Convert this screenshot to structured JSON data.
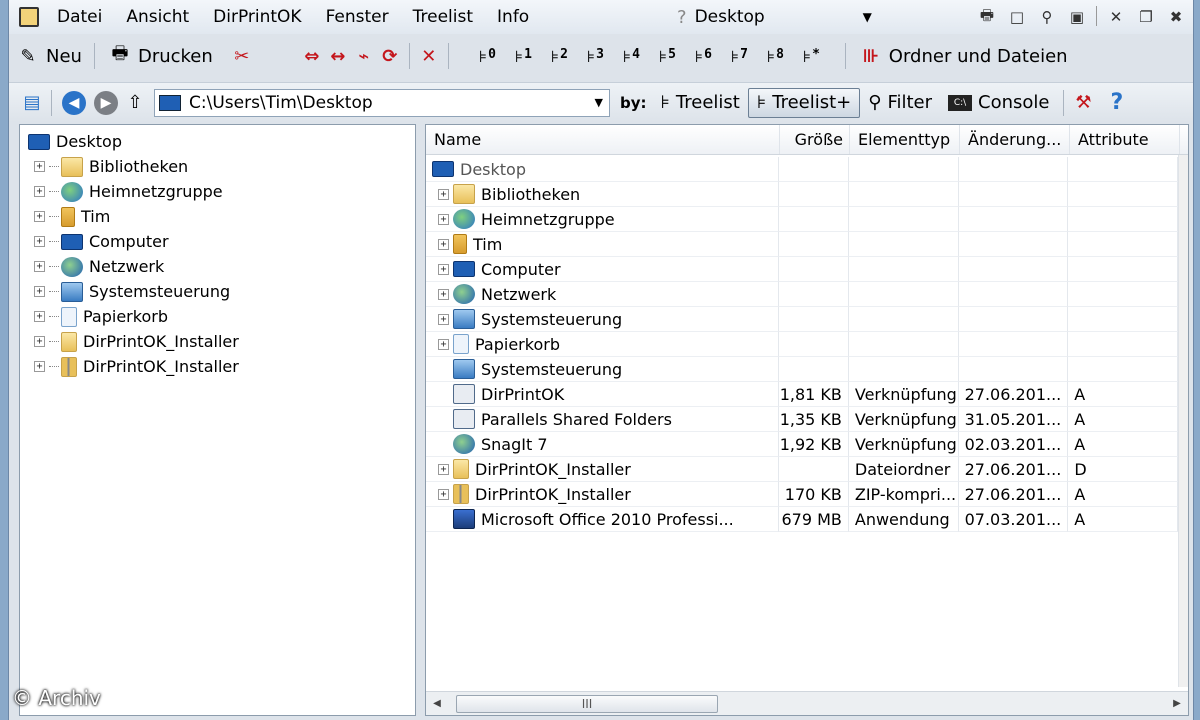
{
  "menu": {
    "items": [
      "Datei",
      "Ansicht",
      "DirPrintOK",
      "Fenster",
      "Treelist",
      "Info"
    ]
  },
  "window_title": "Desktop",
  "toolbar": {
    "new_label": "Neu",
    "print_label": "Drucken",
    "levels": [
      "0",
      "1",
      "2",
      "3",
      "4",
      "5",
      "6",
      "7",
      "8",
      "*"
    ],
    "folders_files_label": "Ordner und Dateien"
  },
  "nav": {
    "path": "C:\\Users\\Tim\\Desktop",
    "by_label": "by:",
    "treelist_label": "Treelist",
    "treelist_plus_label": "Treelist+",
    "filter_label": "Filter",
    "console_label": "Console"
  },
  "tree": {
    "root": "Desktop",
    "items": [
      "Bibliotheken",
      "Heimnetzgruppe",
      "Tim",
      "Computer",
      "Netzwerk",
      "Systemsteuerung",
      "Papierkorb",
      "DirPrintOK_Installer",
      "DirPrintOK_Installer"
    ]
  },
  "list": {
    "columns": {
      "name": "Name",
      "size": "Größe",
      "type": "Elementtyp",
      "date": "Änderung...",
      "attr": "Attribute"
    },
    "root": "Desktop",
    "rows": [
      {
        "name": "Bibliotheken",
        "size": "",
        "type": "",
        "date": "",
        "attr": ""
      },
      {
        "name": "Heimnetzgruppe",
        "size": "",
        "type": "",
        "date": "",
        "attr": ""
      },
      {
        "name": "Tim",
        "size": "",
        "type": "",
        "date": "",
        "attr": ""
      },
      {
        "name": "Computer",
        "size": "",
        "type": "",
        "date": "",
        "attr": ""
      },
      {
        "name": "Netzwerk",
        "size": "",
        "type": "",
        "date": "",
        "attr": ""
      },
      {
        "name": "Systemsteuerung",
        "size": "",
        "type": "",
        "date": "",
        "attr": ""
      },
      {
        "name": "Papierkorb",
        "size": "",
        "type": "",
        "date": "",
        "attr": ""
      },
      {
        "name": "Systemsteuerung",
        "size": "",
        "type": "",
        "date": "",
        "attr": ""
      },
      {
        "name": "DirPrintOK",
        "size": "1,81 KB",
        "type": "Verknüpfung",
        "date": "27.06.201...",
        "attr": "A"
      },
      {
        "name": "Parallels Shared Folders",
        "size": "1,35 KB",
        "type": "Verknüpfung",
        "date": "31.05.201...",
        "attr": "A"
      },
      {
        "name": "SnagIt 7",
        "size": "1,92 KB",
        "type": "Verknüpfung",
        "date": "02.03.201...",
        "attr": "A"
      },
      {
        "name": "DirPrintOK_Installer",
        "size": "",
        "type": "Dateiordner",
        "date": "27.06.201...",
        "attr": "D"
      },
      {
        "name": "DirPrintOK_Installer",
        "size": "170 KB",
        "type": "ZIP-kompri...",
        "date": "27.06.201...",
        "attr": "A"
      },
      {
        "name": "Microsoft Office 2010 Professi...",
        "size": "679 MB",
        "type": "Anwendung",
        "date": "07.03.201...",
        "attr": "A"
      }
    ]
  },
  "scrollbar_grip": "III",
  "watermark": "© Archiv"
}
